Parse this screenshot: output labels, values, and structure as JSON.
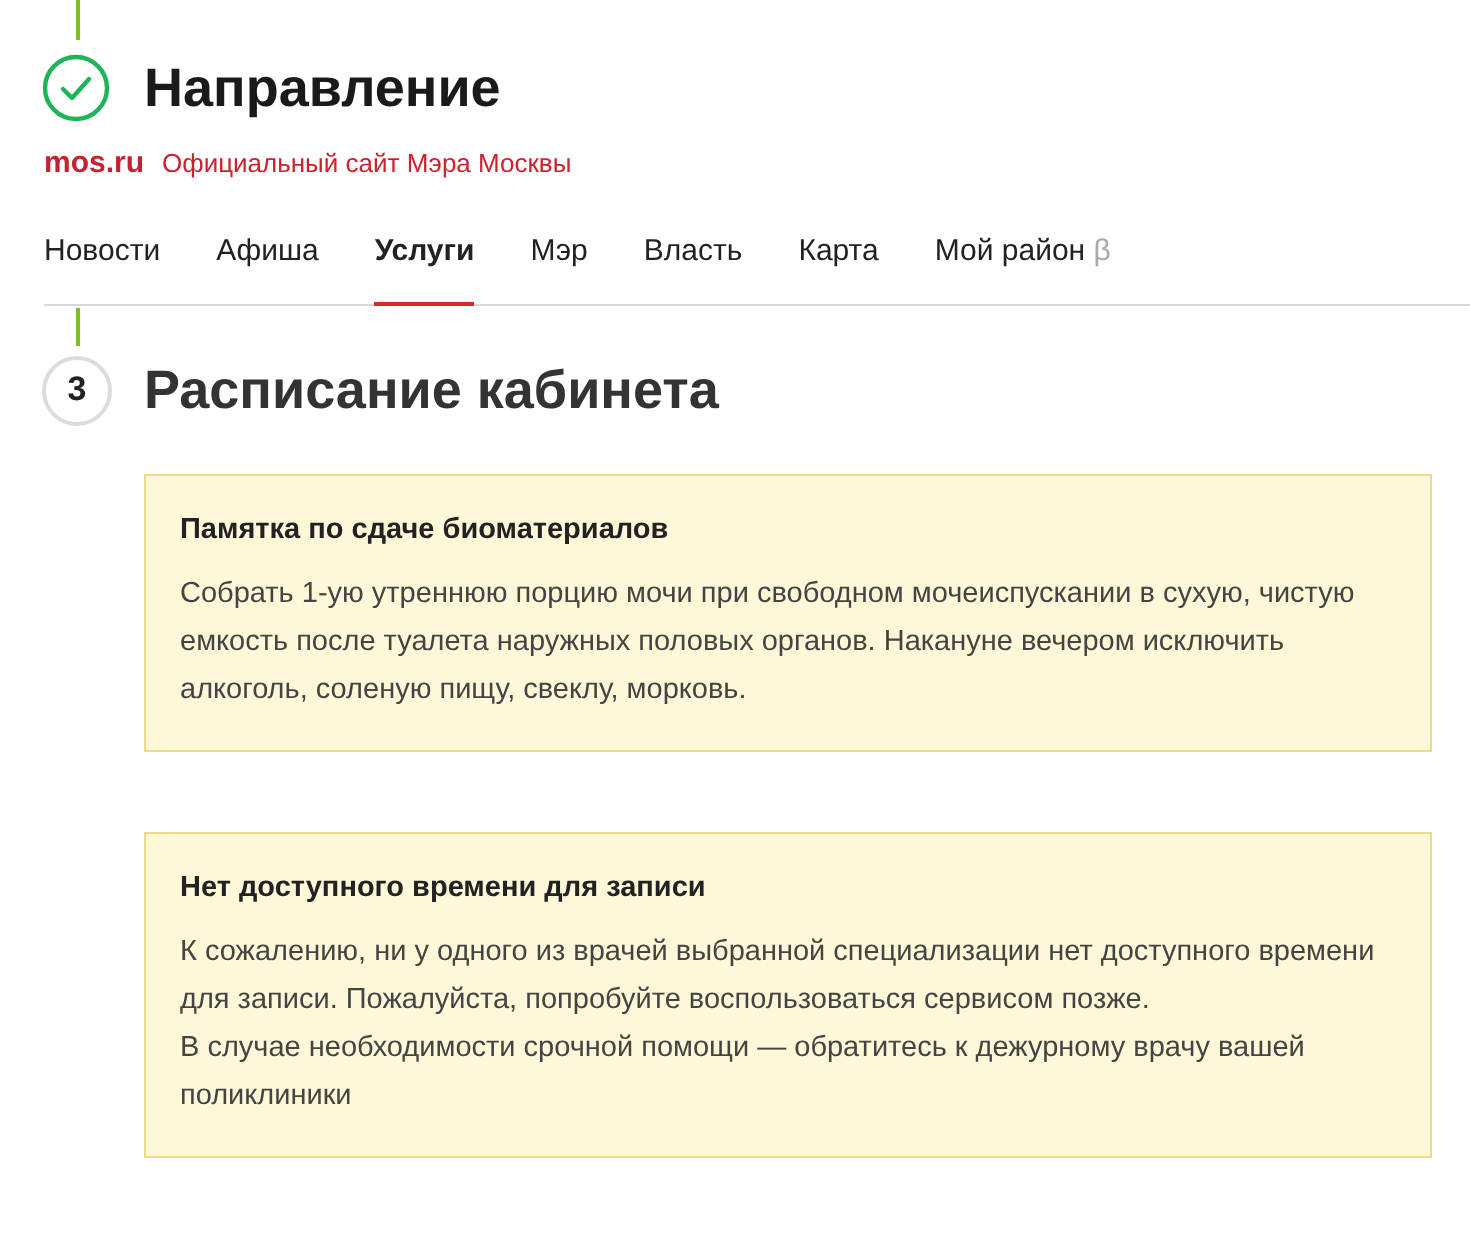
{
  "step_done": {
    "title": "Направление",
    "done": true
  },
  "site": {
    "logo": "mos.ru",
    "tagline": "Официальный сайт Мэра Москвы"
  },
  "nav": [
    {
      "label": "Новости",
      "selected": false
    },
    {
      "label": "Афиша",
      "selected": false
    },
    {
      "label": "Услуги",
      "selected": true
    },
    {
      "label": "Мэр",
      "selected": false
    },
    {
      "label": "Власть",
      "selected": false
    },
    {
      "label": "Карта",
      "selected": false
    },
    {
      "label": "Мой район",
      "badge": "β",
      "selected": false
    }
  ],
  "step": {
    "number": "3",
    "title": "Расписание кабинета",
    "done": false
  },
  "notices": [
    {
      "title": "Памятка по сдаче биоматериалов",
      "paragraphs": [
        "Собрать 1-ую утреннюю порцию мочи при свободном мочеиспускании в сухую, чистую емкость после туалета наружных половых органов. Накануне вечером исключить алкоголь, соленую пищу, свеклу, морковь."
      ]
    },
    {
      "title": "Нет доступного времени для записи",
      "paragraphs": [
        "К сожалению, ни у одного из врачей выбранной специализации нет доступного времени для записи. Пожалуйста, попробуйте воспользоваться сервисом позже.",
        "В случае необходимости срочной помощи — обратитесь к дежурному врачу вашей поликлиники"
      ]
    }
  ]
}
